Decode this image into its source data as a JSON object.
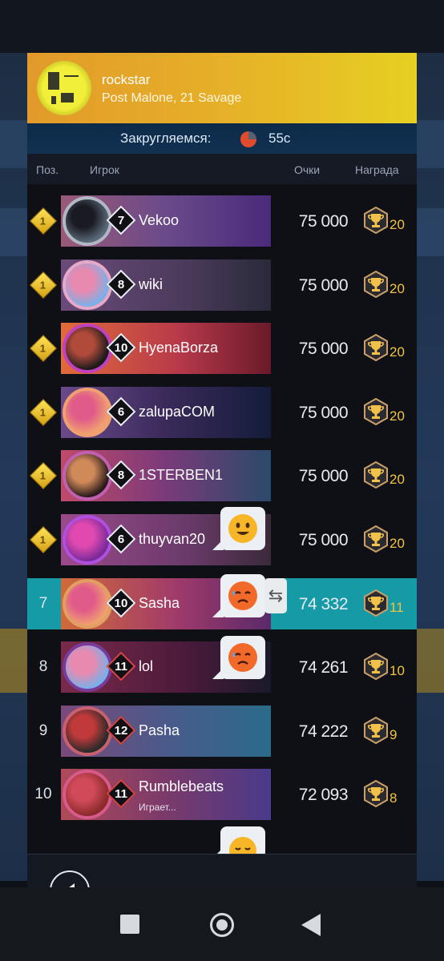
{
  "header": {
    "title": "rockstar",
    "subtitle": "Post Malone, 21 Savage"
  },
  "timer": {
    "label": "Закругляемся:",
    "value": "55c"
  },
  "columns": {
    "pos": "Поз.",
    "player": "Игрок",
    "score": "Очки",
    "reward": "Награда"
  },
  "rows": [
    {
      "pos": "1",
      "leader": true,
      "level": "7",
      "name": "Vekoo",
      "score": "75 000",
      "reward": "20"
    },
    {
      "pos": "1",
      "leader": true,
      "level": "8",
      "name": "wiki",
      "score": "75 000",
      "reward": "20"
    },
    {
      "pos": "1",
      "leader": true,
      "level": "10",
      "name": "HyenaBorza",
      "score": "75 000",
      "reward": "20"
    },
    {
      "pos": "1",
      "leader": true,
      "level": "6",
      "name": "zalupaCOM",
      "score": "75 000",
      "reward": "20"
    },
    {
      "pos": "1",
      "leader": true,
      "level": "8",
      "name": "1STERBEN1",
      "score": "75 000",
      "reward": "20"
    },
    {
      "pos": "1",
      "leader": true,
      "level": "6",
      "name": "thuyvan20",
      "score": "75 000",
      "reward": "20"
    },
    {
      "pos": "7",
      "leader": false,
      "level": "10",
      "name": "Sasha",
      "score": "74 332",
      "reward": "11"
    },
    {
      "pos": "8",
      "leader": false,
      "level": "11",
      "name": "lol",
      "score": "74 261",
      "reward": "10"
    },
    {
      "pos": "9",
      "leader": false,
      "level": "12",
      "name": "Pasha",
      "score": "74 222",
      "reward": "9"
    },
    {
      "pos": "10",
      "leader": false,
      "level": "11",
      "name": "Rumblebeats",
      "status": "Играет...",
      "score": "72 093",
      "reward": "8"
    }
  ],
  "colors": {
    "accent": "#169aa6",
    "gold": "#f0c440"
  }
}
